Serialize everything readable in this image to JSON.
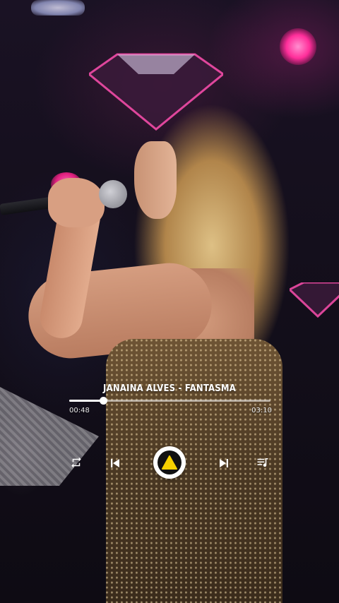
{
  "player": {
    "track_title": "JANAINA ALVES - FANTASMA",
    "elapsed": "00:48",
    "duration": "03:10",
    "progress": 0.17,
    "accent_color": "#f5d000"
  },
  "controls": {
    "repeat_icon": "repeat-icon",
    "previous_icon": "skip-previous-icon",
    "play_icon": "play-icon",
    "next_icon": "skip-next-icon",
    "queue_icon": "playlist-queue-icon"
  }
}
